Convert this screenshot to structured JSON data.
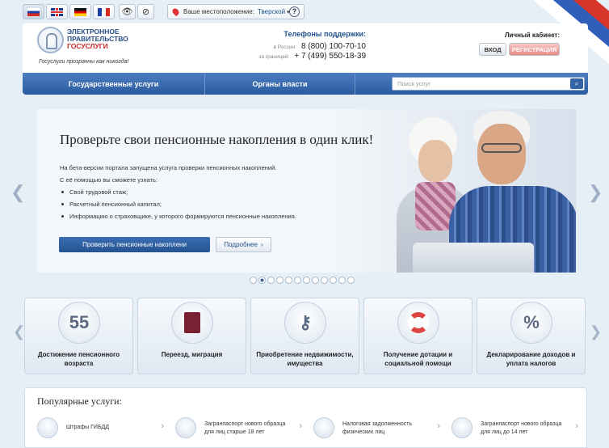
{
  "topbar": {
    "languages": [
      {
        "code": "ru",
        "active": true
      },
      {
        "code": "en",
        "active": false
      },
      {
        "code": "de",
        "active": false
      },
      {
        "code": "fr",
        "active": false
      }
    ],
    "location_label": "Ваше местоположение:",
    "location_value": "Тверской",
    "help": "?"
  },
  "header": {
    "logo_line1": "ЭЛЕКТРОННОЕ",
    "logo_line2": "ПРАВИТЕЛЬСТВО",
    "logo_line3": "ГОСУСЛУГИ",
    "slogan": "Госуслуги прозрачны как никогда!",
    "phones_title": "Телефоны поддержки:",
    "phone_ru_label": "в России:",
    "phone_ru": "8 (800) 100-70-10",
    "phone_abroad_label": "за границей:",
    "phone_abroad": "+ 7 (499) 550-18-39",
    "cabinet_title": "Личный кабинет:",
    "login": "ВХОД",
    "register": "РЕГИСТРАЦИЯ"
  },
  "nav": {
    "item1": "Государственные услуги",
    "item2": "Органы власти",
    "search_placeholder": "Поиск услуг"
  },
  "banner": {
    "title": "Проверьте свои пенсионные накопления в один клик!",
    "intro1": "На бета-версии портала запущена услуга проверки пенсионных накоплений.",
    "intro2": "С её помощью вы сможете узнать:",
    "bullets": [
      "Свой трудовой стаж;",
      "Расчетный пенсионный капитал;",
      "Информацию о страховщике, у которого формируются пенсионные накопления."
    ],
    "primary_button": "Проверить пенсионные накоплени",
    "more_button": "Подробнее"
  },
  "slider": {
    "count": 12,
    "active": 1
  },
  "tiles": [
    {
      "label": "Достижение пенсионного возраста",
      "icon": "55"
    },
    {
      "label": "Переезд, миграция",
      "icon": "passport"
    },
    {
      "label": "Приобретение недвижимости, имущества",
      "icon": "keys"
    },
    {
      "label": "Получение дотации и социальной помощи",
      "icon": "lifebuoy"
    },
    {
      "label": "Декларирование доходов и уплата налогов",
      "icon": "%"
    }
  ],
  "popular": {
    "title": "Популярные услуги:",
    "items": [
      {
        "label": "Штрафы ГИБДД"
      },
      {
        "label": "Загранпаспорт нового образца для лиц старше 18 лет"
      },
      {
        "label": "Налоговая задолженность физических лиц"
      },
      {
        "label": "Загранпаспорт нового образца для лиц до 14 лет"
      }
    ]
  }
}
